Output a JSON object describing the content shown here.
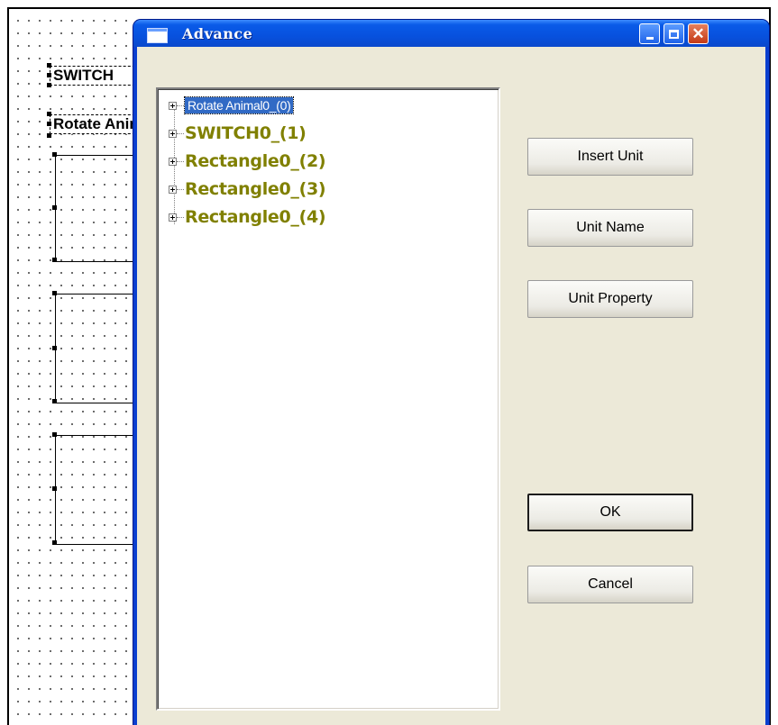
{
  "background": {
    "labels": [
      {
        "text": "SWITCH"
      },
      {
        "text": "Rotate Animal"
      }
    ]
  },
  "dialog": {
    "title": "Advance",
    "tree": {
      "items": [
        {
          "label": "Rotate Animal0_(0)",
          "selected": true
        },
        {
          "label": "SWITCH0_(1)",
          "selected": false
        },
        {
          "label": "Rectangle0_(2)",
          "selected": false
        },
        {
          "label": "Rectangle0_(3)",
          "selected": false
        },
        {
          "label": "Rectangle0_(4)",
          "selected": false
        }
      ]
    },
    "buttons": {
      "insert_unit": "Insert Unit",
      "unit_name": "Unit Name",
      "unit_property": "Unit Property",
      "ok": "OK",
      "cancel": "Cancel"
    }
  },
  "colors": {
    "node_text": "#808000",
    "selection": "#316ac5",
    "titlebar": "#0751de",
    "dialog_face": "#ece9d8"
  }
}
